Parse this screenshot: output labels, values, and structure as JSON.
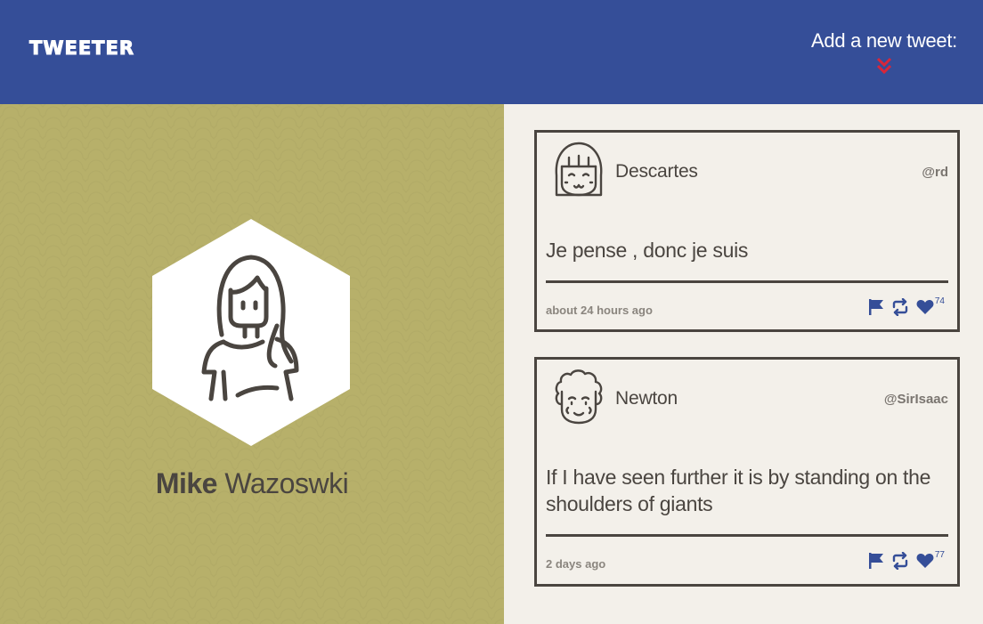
{
  "header": {
    "logo": "TWEETER",
    "compose_label": "Add a new tweet:"
  },
  "profile": {
    "first_name": "Mike",
    "last_name": "Wazoswki"
  },
  "tweets": [
    {
      "author": "Descartes",
      "handle": "@rd",
      "text": "Je pense , donc je suis",
      "time": "about 24 hours ago",
      "likes": "74"
    },
    {
      "author": "Newton",
      "handle": "@SirIsaac",
      "text": "If I have seen further it is by standing on the shoulders of giants",
      "time": "2 days ago",
      "likes": "77"
    }
  ],
  "colors": {
    "header_bg": "#354e98",
    "profile_bg": "#b7b06a",
    "feed_bg": "#f3f0ea",
    "accent_red": "#d9263a",
    "icon_blue": "#354e98",
    "ink": "#4a4540"
  },
  "icons": {
    "compose": "double-chevron-down-icon",
    "flag": "flag-icon",
    "retweet": "retweet-icon",
    "like": "heart-icon"
  }
}
